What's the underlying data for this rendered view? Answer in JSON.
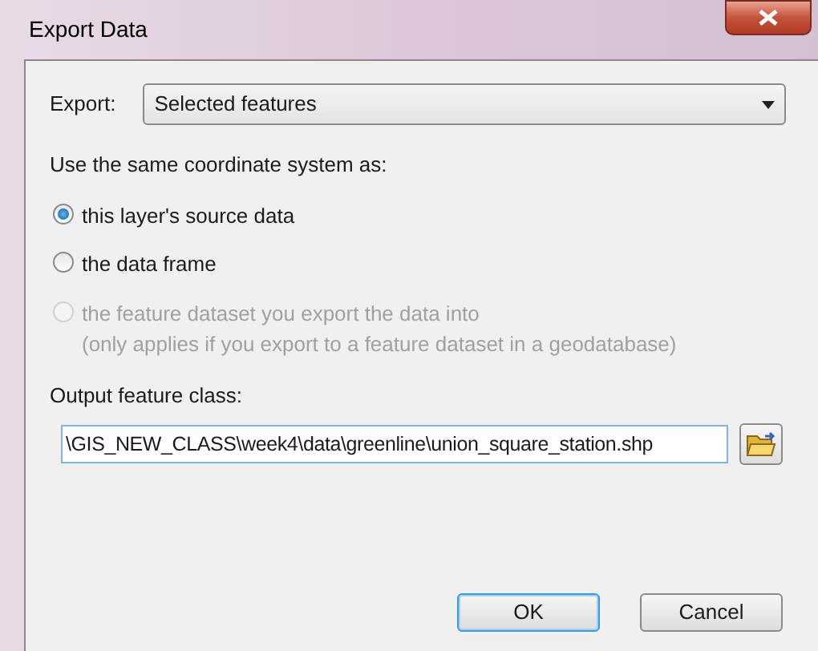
{
  "window": {
    "title": "Export Data"
  },
  "export": {
    "label": "Export:",
    "value": "Selected features"
  },
  "coordinate_system": {
    "label": "Use the same coordinate system as:",
    "options": [
      {
        "label": "this layer's source data",
        "selected": true,
        "disabled": false
      },
      {
        "label": "the data frame",
        "selected": false,
        "disabled": false
      },
      {
        "label": "the feature dataset you export the data into",
        "note": "(only applies if you export to a feature dataset in a geodatabase)",
        "selected": false,
        "disabled": true
      }
    ]
  },
  "output": {
    "label": "Output feature class:",
    "value": "\\GIS_NEW_CLASS\\week4\\data\\greenline\\union_square_station.shp"
  },
  "buttons": [
    {
      "label": "OK",
      "default": true
    },
    {
      "label": "Cancel",
      "default": false
    }
  ]
}
